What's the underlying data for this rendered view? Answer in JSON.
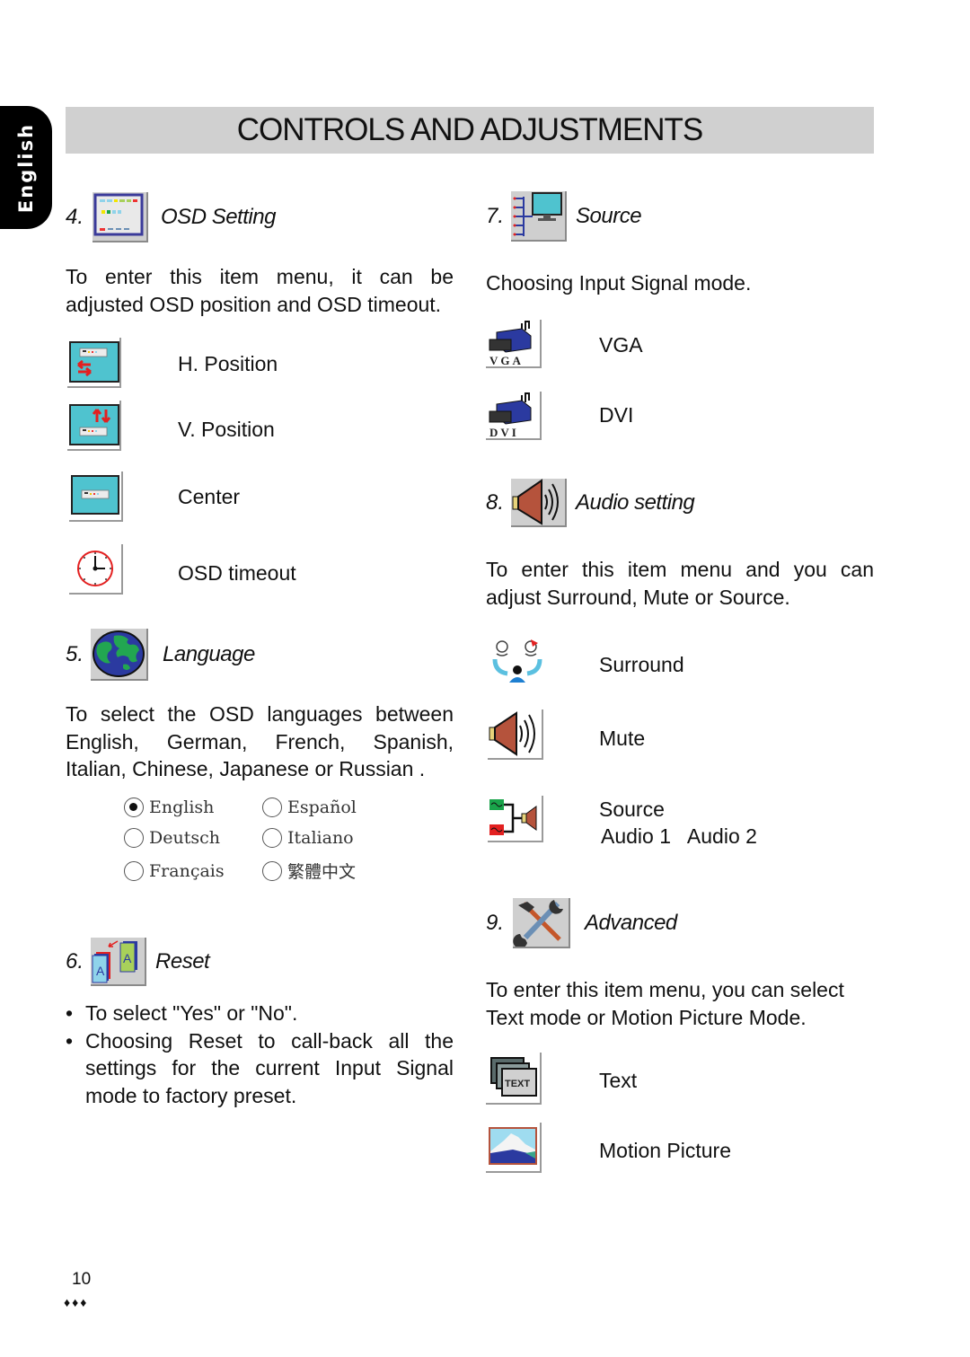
{
  "side_tab": {
    "label": "English"
  },
  "header": {
    "title": "CONTROLS AND ADJUSTMENTS"
  },
  "sections": {
    "osd": {
      "number": "4.",
      "title": "OSD Setting",
      "description": "To enter this item menu, it can be adjusted OSD position and OSD timeout.",
      "items": [
        {
          "label": "H. Position",
          "icon": "h-position-icon"
        },
        {
          "label": "V. Position",
          "icon": "v-position-icon"
        },
        {
          "label": "Center",
          "icon": "center-icon"
        },
        {
          "label": "OSD timeout",
          "icon": "clock-icon"
        }
      ]
    },
    "language": {
      "number": "5.",
      "title": "Language",
      "description": "To select the OSD languages between English, German, French, Spanish, Italian, Chinese, Japanese or Russian .",
      "options": [
        {
          "label": "English",
          "selected": true
        },
        {
          "label": "Español",
          "selected": false
        },
        {
          "label": "Deutsch",
          "selected": false
        },
        {
          "label": "Italiano",
          "selected": false
        },
        {
          "label": "Français",
          "selected": false
        },
        {
          "label": "繁體中文",
          "selected": false
        }
      ]
    },
    "reset": {
      "number": "6.",
      "title": "Reset",
      "bullets": [
        "To select \"Yes\" or \"No\".",
        "Choosing Reset to call-back all the settings for the current Input Signal mode to factory preset."
      ]
    },
    "source": {
      "number": "7.",
      "title": "Source",
      "description": "Choosing Input Signal mode.",
      "items": [
        {
          "label": "VGA",
          "icon_caption": "VGA"
        },
        {
          "label": "DVI",
          "icon_caption": "DVI"
        }
      ]
    },
    "audio": {
      "number": "8.",
      "title": "Audio setting",
      "description": "To enter this item menu and you can adjust Surround, Mute or Source.",
      "items": [
        {
          "label": "Surround"
        },
        {
          "label": "Mute"
        },
        {
          "label": "Source",
          "sublabel": "Audio 1   Audio 2"
        }
      ]
    },
    "advanced": {
      "number": "9.",
      "title": "Advanced",
      "description": "To enter this item menu, you can select Text mode or Motion Picture Mode.",
      "items": [
        {
          "label": "Text",
          "icon_caption": "TEXT"
        },
        {
          "label": "Motion Picture"
        }
      ]
    }
  },
  "footer": {
    "page_number": "10",
    "ornament": "♦♦♦"
  },
  "colors": {
    "title_bar": "#d0d0d0",
    "icon_bg": "#cfcfcf",
    "osd_screen": "#4fc3cf",
    "accent_red": "#e32020"
  }
}
